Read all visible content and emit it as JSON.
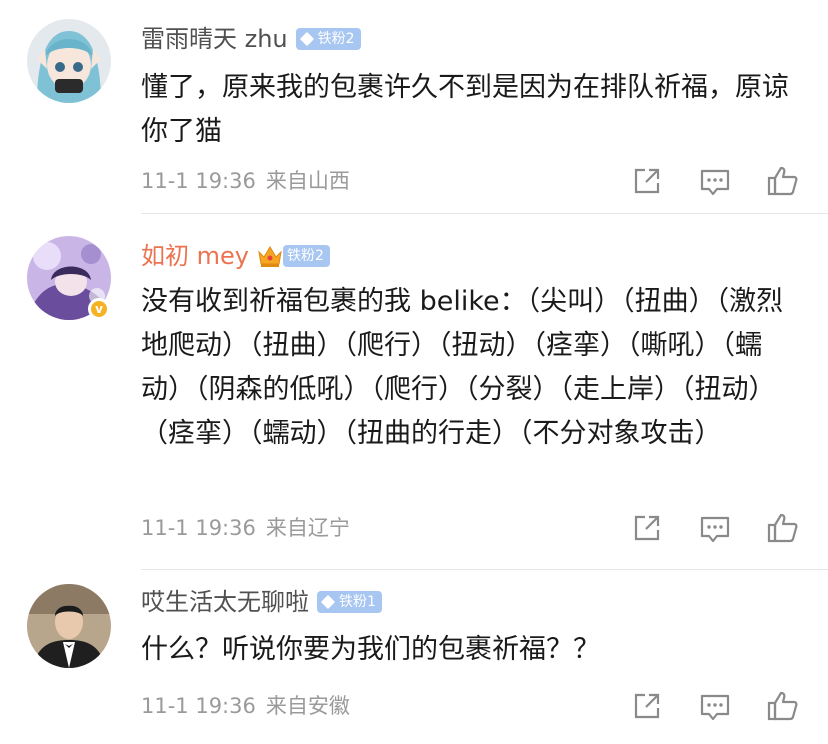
{
  "comments": [
    {
      "username": "雷雨晴天 zhu",
      "fan_badge": "铁粉2",
      "text": "懂了，原来我的包裹许久不到是因为在排队祈福，原谅你了猫",
      "time": "11-1 19:36",
      "source": "来自山西"
    },
    {
      "username": "如初 mey",
      "fan_badge": "铁粉2",
      "verified_mark": "v",
      "text": "没有收到祈福包裹的我 belike：（尖叫）（扭曲）（激烈地爬动）（扭曲）（爬行）（扭动）（痉挛）（嘶吼）（蠕动）（阴森的低吼）（爬行）（分裂）（走上岸）（扭动）（痉挛）（蠕动）（扭曲的行走）（不分对象攻击）",
      "time": "11-1 19:36",
      "source": "来自辽宁"
    },
    {
      "username": "哎生活太无聊啦",
      "fan_badge": "铁粉1",
      "text": "什么？听说你要为我们的包裹祈福？？",
      "time": "11-1 19:36",
      "source": "来自安徽"
    }
  ],
  "icons": {
    "share": "share-icon",
    "comment": "comment-icon",
    "like": "like-icon"
  },
  "colors": {
    "vip_name": "#eb7350",
    "fan_badge": "#a7c6f2",
    "verified": "#f5b323",
    "meta_text": "#9a9a9a"
  }
}
